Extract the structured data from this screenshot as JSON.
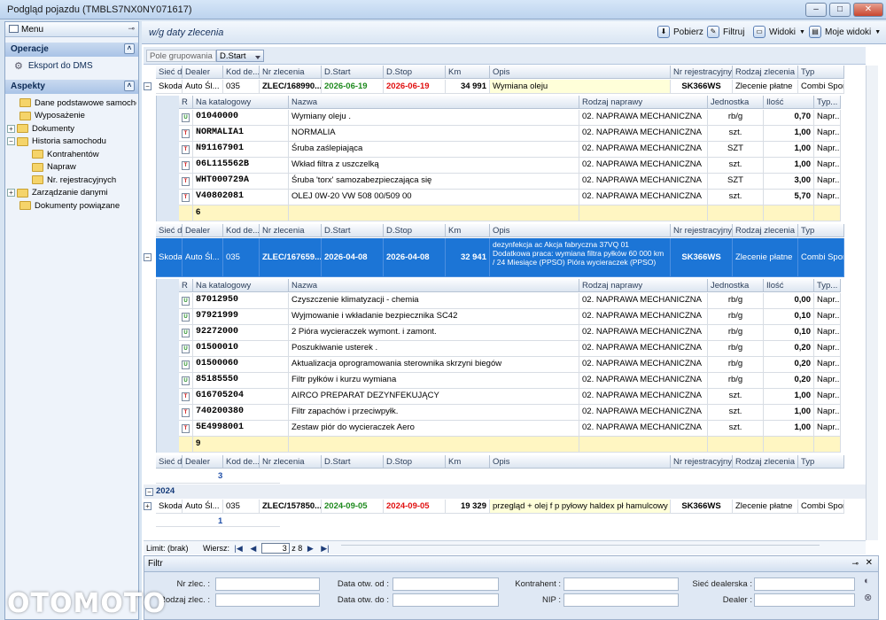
{
  "window": {
    "title": "Podgląd pojazdu (TMBLS7NX0NY071617)",
    "min": "–",
    "max": "□",
    "close": "✕"
  },
  "left": {
    "menu_label": "Menu",
    "operacje": {
      "label": "Operacje",
      "items": [
        {
          "label": "Eksport do DMS"
        }
      ]
    },
    "aspekty": {
      "label": "Aspekty",
      "tree": [
        {
          "label": "Dane podstawowe samochodu",
          "indent": 1,
          "exp": ""
        },
        {
          "label": "Wyposażenie",
          "indent": 1,
          "exp": ""
        },
        {
          "label": "Dokumenty",
          "indent": 0,
          "exp": "+"
        },
        {
          "label": "Historia samochodu",
          "indent": 0,
          "exp": "−"
        },
        {
          "label": "Kontrahentów",
          "indent": 2,
          "exp": ""
        },
        {
          "label": "Napraw",
          "indent": 2,
          "exp": ""
        },
        {
          "label": "Nr. rejestracyjnych",
          "indent": 2,
          "exp": ""
        },
        {
          "label": "Zarządzanie danymi",
          "indent": 0,
          "exp": "+"
        },
        {
          "label": "Dokumenty powiązane",
          "indent": 1,
          "exp": ""
        }
      ]
    }
  },
  "header": {
    "title": "w/g daty zlecenia",
    "pobierz": "Pobierz",
    "filtruj": "Filtruj",
    "widoki": "Widoki",
    "moje_widoki": "Moje widoki"
  },
  "group_bar": {
    "placeholder": "Pole grupowania",
    "chip": "D.Start"
  },
  "orders_header": [
    "Sieć deale...",
    "Dealer",
    "Kod de...",
    "Nr zlecenia",
    "D.Start",
    "D.Stop",
    "Km",
    "Opis",
    "Nr rejestracyjny",
    "Rodzaj zlecenia",
    "Typ"
  ],
  "orders": [
    {
      "siec": "Skoda",
      "dealer": "Auto Śl...",
      "kod": "035",
      "nr": "ZLEC/168990...",
      "start": "2026-06-19",
      "stop": "2026-06-19",
      "km": "34 991",
      "opis": "Wymiana oleju",
      "rej": "SK366WS",
      "rodzaj": "Zlecenie płatne",
      "typ": "Combi Sport",
      "parts": [
        {
          "ic": "U",
          "kat": "01040000",
          "nazwa": "Wymiany oleju .",
          "rodzaj": "02. NAPRAWA MECHANICZNA",
          "jedn": "rb/g",
          "ilosc": "0,70",
          "typ": "Napr..."
        },
        {
          "ic": "T",
          "kat": "NORMALIA1",
          "nazwa": "NORMALIA",
          "rodzaj": "02. NAPRAWA MECHANICZNA",
          "jedn": "szt.",
          "ilosc": "1,00",
          "typ": "Napr..."
        },
        {
          "ic": "T",
          "kat": "N91167901",
          "nazwa": "Śruba zaślepiająca",
          "rodzaj": "02. NAPRAWA MECHANICZNA",
          "jedn": "SZT",
          "ilosc": "1,00",
          "typ": "Napr..."
        },
        {
          "ic": "T",
          "kat": "06L115562B",
          "nazwa": "Wkład filtra z uszczelką",
          "rodzaj": "02. NAPRAWA MECHANICZNA",
          "jedn": "szt.",
          "ilosc": "1,00",
          "typ": "Napr..."
        },
        {
          "ic": "T",
          "kat": "WHT000729A",
          "nazwa": "Śruba 'torx' samozabezpieczająca się",
          "rodzaj": "02. NAPRAWA MECHANICZNA",
          "jedn": "SZT",
          "ilosc": "3,00",
          "typ": "Napr..."
        },
        {
          "ic": "T",
          "kat": "V40802081",
          "nazwa": "OLEJ 0W-20 VW 508 00/509 00",
          "rodzaj": "02. NAPRAWA MECHANICZNA",
          "jedn": "szt.",
          "ilosc": "5,70",
          "typ": "Napr..."
        }
      ],
      "count": "6"
    },
    {
      "siec": "Skoda",
      "dealer": "Auto Śl...",
      "kod": "035",
      "nr": "ZLEC/167659...",
      "start": "2026-04-08",
      "stop": "2026-04-08",
      "km": "32 941",
      "opis": "dezynfekcja ac Akcja fabryczna 37VQ       01 Dodatkowa praca: wymiana filtra pyłków 60 000 km / 24 Miesiące (PPSO) Pióra wycieraczek (PPSO)",
      "rej": "SK366WS",
      "rodzaj": "Zlecenie płatne",
      "typ": "Combi Sport",
      "parts": [
        {
          "ic": "U",
          "kat": "87012950",
          "nazwa": "Czyszczenie klimatyzacji - chemia",
          "rodzaj": "02. NAPRAWA MECHANICZNA",
          "jedn": "rb/g",
          "ilosc": "0,00",
          "typ": "Napr..."
        },
        {
          "ic": "U",
          "kat": "97921999",
          "nazwa": "Wyjmowanie i wkładanie bezpiecznika SC42",
          "rodzaj": "02. NAPRAWA MECHANICZNA",
          "jedn": "rb/g",
          "ilosc": "0,10",
          "typ": "Napr..."
        },
        {
          "ic": "U",
          "kat": "92272000",
          "nazwa": "2 Pióra wycieraczek wymont. i zamont.",
          "rodzaj": "02. NAPRAWA MECHANICZNA",
          "jedn": "rb/g",
          "ilosc": "0,10",
          "typ": "Napr..."
        },
        {
          "ic": "U",
          "kat": "01500010",
          "nazwa": "Poszukiwanie usterek .",
          "rodzaj": "02. NAPRAWA MECHANICZNA",
          "jedn": "rb/g",
          "ilosc": "0,20",
          "typ": "Napr..."
        },
        {
          "ic": "U",
          "kat": "01500060",
          "nazwa": "Aktualizacja oprogramowania sterownika skrzyni biegów",
          "rodzaj": "02. NAPRAWA MECHANICZNA",
          "jedn": "rb/g",
          "ilosc": "0,20",
          "typ": "Napr..."
        },
        {
          "ic": "U",
          "kat": "85185550",
          "nazwa": "Filtr pyłków i kurzu wymiana",
          "rodzaj": "02. NAPRAWA MECHANICZNA",
          "jedn": "rb/g",
          "ilosc": "0,20",
          "typ": "Napr..."
        },
        {
          "ic": "T",
          "kat": "G16705204",
          "nazwa": "AIRCO PREPARAT DEZYNFEKUJĄCY",
          "rodzaj": "02. NAPRAWA MECHANICZNA",
          "jedn": "szt.",
          "ilosc": "1,00",
          "typ": "Napr..."
        },
        {
          "ic": "T",
          "kat": "740200380",
          "nazwa": "Filtr zapachów i przeciwpyłk.",
          "rodzaj": "02. NAPRAWA MECHANICZNA",
          "jedn": "szt.",
          "ilosc": "1,00",
          "typ": "Napr..."
        },
        {
          "ic": "T",
          "kat": "5E4998001",
          "nazwa": "Zestaw piór do wycieraczek Aero",
          "rodzaj": "02. NAPRAWA MECHANICZNA",
          "jedn": "szt.",
          "ilosc": "1,00",
          "typ": "Napr..."
        }
      ],
      "count": "9"
    }
  ],
  "parts_header": [
    "R",
    "Na katalogowy",
    "Nazwa",
    "Rodzaj naprawy",
    "Jednostka",
    "Ilość",
    "Typ..."
  ],
  "group_count": "3",
  "group2": {
    "year": "2024",
    "order": {
      "siec": "Skoda",
      "dealer": "Auto Śl...",
      "kod": "035",
      "nr": "ZLEC/157850...",
      "start": "2024-09-05",
      "stop": "2024-09-05",
      "km": "19 329",
      "opis": "przegląd + olej f p pyłowy haldex pł hamulcowy",
      "rej": "SK366WS",
      "rodzaj": "Zlecenie płatne",
      "typ": "Combi Sport"
    },
    "count": "1"
  },
  "pager": {
    "limit": "Limit: (brak)",
    "wiersz": "Wiersz:",
    "current": "3",
    "of": "z",
    "total": "8"
  },
  "filter": {
    "title": "Filtr",
    "fields": [
      "Nr zlec. :",
      "Rodzaj zlec. :",
      "Data otw. od :",
      "Data otw. do :",
      "Kontrahent :",
      "NIP :",
      "Sieć dealerska :",
      "Dealer :"
    ]
  },
  "logo": "OTOMOTO"
}
